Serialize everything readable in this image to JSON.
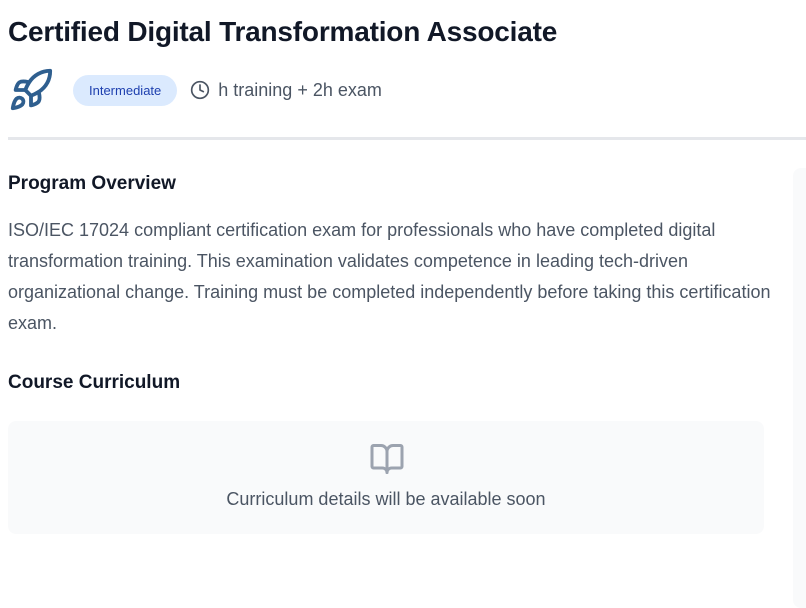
{
  "course": {
    "title": "Certified Digital Transformation Associate",
    "icon": "rocket-icon",
    "level": "Intermediate",
    "duration": "h training + 2h exam"
  },
  "overview": {
    "heading": "Program Overview",
    "text": "ISO/IEC 17024 compliant certification exam for professionals who have completed digital transformation training. This examination validates competence in leading tech-driven organizational change. Training must be completed independently before taking this certification exam."
  },
  "curriculum": {
    "heading": "Course Curriculum",
    "icon": "book-open-icon",
    "empty_message": "Curriculum details will be available soon"
  },
  "colors": {
    "accent": "#2f5f8f",
    "badge_bg": "#dbeafe",
    "badge_text": "#1e40af",
    "divider": "#e5e7eb"
  }
}
